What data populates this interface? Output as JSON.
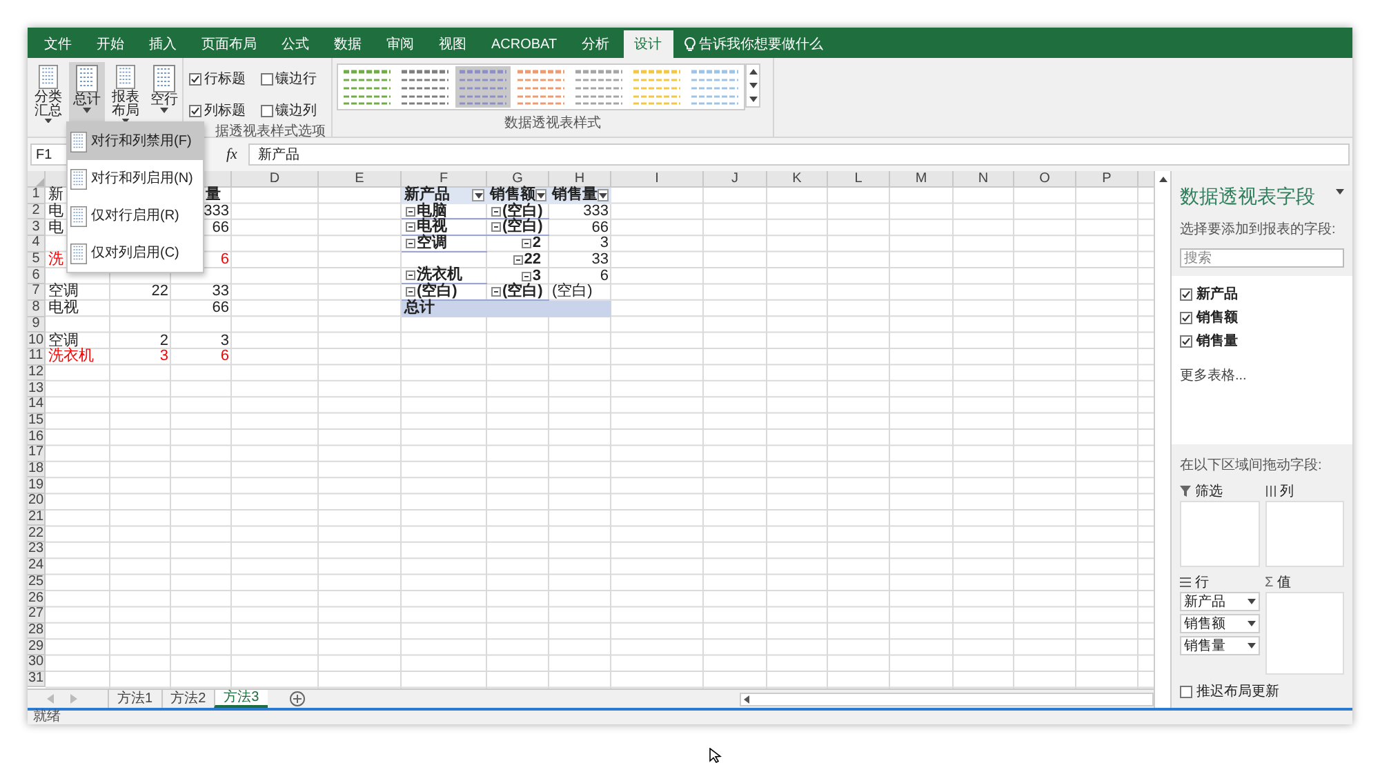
{
  "ribbon": {
    "tabs": [
      {
        "label": "文件",
        "selected": false
      },
      {
        "label": "开始",
        "selected": false
      },
      {
        "label": "插入",
        "selected": false
      },
      {
        "label": "页面布局",
        "selected": false
      },
      {
        "label": "公式",
        "selected": false
      },
      {
        "label": "数据",
        "selected": false
      },
      {
        "label": "审阅",
        "selected": false
      },
      {
        "label": "视图",
        "selected": false
      },
      {
        "label": "ACROBAT",
        "selected": false
      },
      {
        "label": "分析",
        "selected": false
      },
      {
        "label": "设计",
        "selected": true
      }
    ],
    "tell_me": "告诉我你想要做什么",
    "layout_buttons": [
      {
        "label": "分类汇总",
        "pressed": false
      },
      {
        "label": "总计",
        "pressed": true
      },
      {
        "label": "报表布局",
        "pressed": false
      },
      {
        "label": "空行",
        "pressed": false
      }
    ],
    "style_options": {
      "checkboxes": [
        {
          "label": "行标题",
          "checked": true
        },
        {
          "label": "镶边行",
          "checked": false
        },
        {
          "label": "列标题",
          "checked": true
        },
        {
          "label": "镶边列",
          "checked": false
        }
      ],
      "group_label": "据透视表样式选项"
    },
    "styles": {
      "items": [
        {
          "color": "#70ad47",
          "selected": false
        },
        {
          "color": "#7f7f7f",
          "selected": false
        },
        {
          "color": "#8e8fc8",
          "selected": true
        },
        {
          "color": "#ed9b6f",
          "selected": false
        },
        {
          "color": "#a5a5a5",
          "selected": false
        },
        {
          "color": "#f2c744",
          "selected": false
        },
        {
          "color": "#9dc3e6",
          "selected": false
        }
      ],
      "group_label": "数据透视表样式"
    }
  },
  "total_menu": [
    {
      "label": "对行和列禁用(F)",
      "selected": true
    },
    {
      "label": "对行和列启用(N)",
      "selected": false
    },
    {
      "label": "仅对行启用(R)",
      "selected": false
    },
    {
      "label": "仅对列启用(C)",
      "selected": false
    }
  ],
  "formula_bar": {
    "name_box": "F1",
    "function_label": "fx",
    "formula": "新产品"
  },
  "grid": {
    "column_headers": [
      "D",
      "E",
      "F",
      "G",
      "H",
      "I",
      "J",
      "K",
      "L",
      "M",
      "N",
      "O",
      "P"
    ],
    "rows": [
      {
        "row": "1",
        "cells": {
          "A": {
            "text": "新"
          },
          "C": {
            "text": "量",
            "kind": "partial-header"
          },
          "F": {
            "text": "新产品",
            "kind": "pivot-header"
          },
          "G": {
            "text": "销售额",
            "kind": "pivot-header"
          },
          "H": {
            "text": "销售量",
            "kind": "pivot-header"
          }
        }
      },
      {
        "row": "2",
        "cells": {
          "A": {
            "text": "电"
          },
          "C": {
            "text": "333",
            "kind": "number"
          },
          "F": {
            "text": "电脑",
            "kind": "pivot-item"
          },
          "G": {
            "text": "(空白)",
            "kind": "pivot-item"
          },
          "H": {
            "text": "333",
            "kind": "number"
          }
        }
      },
      {
        "row": "3",
        "cells": {
          "A": {
            "text": "电"
          },
          "C": {
            "text": "66",
            "kind": "number"
          },
          "F": {
            "text": "电视",
            "kind": "pivot-item"
          },
          "G": {
            "text": "(空白)",
            "kind": "pivot-item"
          },
          "H": {
            "text": "66",
            "kind": "number"
          }
        }
      },
      {
        "row": "4",
        "cells": {
          "F": {
            "text": "空调",
            "kind": "pivot-item"
          },
          "G": {
            "text": "2",
            "kind": "pivot-subitem"
          },
          "H": {
            "text": "3",
            "kind": "number"
          }
        }
      },
      {
        "row": "5",
        "cells": {
          "A": {
            "text": "洗",
            "color": "#ff0000"
          },
          "C": {
            "text": "6",
            "kind": "number",
            "color": "#ff0000"
          },
          "G": {
            "text": "22",
            "kind": "pivot-subitem"
          },
          "H": {
            "text": "33",
            "kind": "number"
          }
        }
      },
      {
        "row": "6",
        "cells": {
          "F": {
            "text": "洗衣机",
            "kind": "pivot-item"
          },
          "G": {
            "text": "3",
            "kind": "pivot-subitem"
          },
          "H": {
            "text": "6",
            "kind": "number"
          }
        }
      },
      {
        "row": "7",
        "cells": {
          "A": {
            "text": "空调"
          },
          "B": {
            "text": "22",
            "kind": "number"
          },
          "C": {
            "text": "33",
            "kind": "number"
          },
          "F": {
            "text": "(空白)",
            "kind": "pivot-item"
          },
          "G": {
            "text": "(空白)",
            "kind": "pivot-item"
          },
          "H": {
            "text": "(空白)"
          }
        }
      },
      {
        "row": "8",
        "kind": "total",
        "cells": {
          "A": {
            "text": "电视"
          },
          "C": {
            "text": "66",
            "kind": "number"
          },
          "F": {
            "text": "总计",
            "kind": "total"
          }
        }
      },
      {
        "row": "9"
      },
      {
        "row": "10",
        "cells": {
          "A": {
            "text": "空调"
          },
          "B": {
            "text": "2",
            "kind": "number"
          },
          "C": {
            "text": "3",
            "kind": "number"
          }
        }
      },
      {
        "row": "11",
        "cells": {
          "A": {
            "text": "洗衣机",
            "color": "#ff0000"
          },
          "B": {
            "text": "3",
            "kind": "number",
            "color": "#ff0000"
          },
          "C": {
            "text": "6",
            "kind": "number",
            "color": "#ff0000"
          }
        }
      },
      {
        "row": "12"
      },
      {
        "row": "13"
      },
      {
        "row": "14"
      },
      {
        "row": "15"
      },
      {
        "row": "16"
      },
      {
        "row": "17"
      },
      {
        "row": "18"
      },
      {
        "row": "19"
      },
      {
        "row": "20"
      },
      {
        "row": "21"
      },
      {
        "row": "22"
      },
      {
        "row": "23"
      },
      {
        "row": "24"
      },
      {
        "row": "25"
      },
      {
        "row": "26"
      },
      {
        "row": "27"
      },
      {
        "row": "28"
      },
      {
        "row": "29"
      },
      {
        "row": "30"
      },
      {
        "row": "31"
      }
    ]
  },
  "sheet_tabs": [
    {
      "label": "方法1",
      "selected": false
    },
    {
      "label": "方法2",
      "selected": false
    },
    {
      "label": "方法3",
      "selected": true
    }
  ],
  "pivot_pane": {
    "title": "数据透视表字段",
    "instruction": "选择要添加到报表的字段:",
    "search_placeholder": "搜索",
    "fields": [
      {
        "label": "新产品",
        "checked": true
      },
      {
        "label": "销售额",
        "checked": true
      },
      {
        "label": "销售量",
        "checked": true
      }
    ],
    "more_tables": "更多表格...",
    "drag_hint": "在以下区域间拖动字段:",
    "areas": {
      "filter": {
        "label": "筛选"
      },
      "columns": {
        "label": "列"
      },
      "rows": {
        "label": "行",
        "items": [
          "新产品",
          "销售额",
          "销售量"
        ]
      },
      "values": {
        "symbol": "Σ",
        "label": "值"
      }
    },
    "defer_update": {
      "label": "推迟布局更新",
      "checked": false
    }
  },
  "status_bar": {
    "text": "就绪"
  }
}
